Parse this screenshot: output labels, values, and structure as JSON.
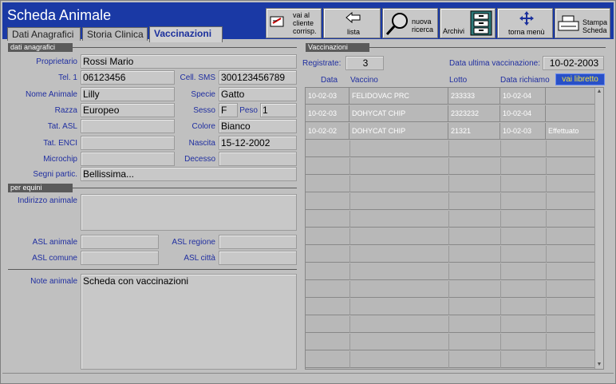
{
  "app": {
    "title": "Scheda Animale"
  },
  "tabs": [
    {
      "label": "Dati Anagrafici"
    },
    {
      "label": "Storia Clinica"
    },
    {
      "label": "Vaccinazioni"
    }
  ],
  "toolbar": {
    "vai_cliente": "vai al cliente corrisp.",
    "lista": "lista",
    "nuova_ricerca": "nuova ricerca",
    "archivi": "Archivi",
    "torna_menu": "torna menù",
    "stampa": "Stampa Scheda"
  },
  "sections": {
    "dati_anagrafici": "dati anagrafici",
    "per_equini": "per equini",
    "vaccinazioni": "Vaccinazioni"
  },
  "form": {
    "proprietario": {
      "label": "Proprietario",
      "value": "Rossi Mario"
    },
    "tel1": {
      "label": "Tel. 1",
      "value": "06123456"
    },
    "cell": {
      "label": "Cell. SMS",
      "value": "300123456789"
    },
    "nome": {
      "label": "Nome Animale",
      "value": "Lilly"
    },
    "specie": {
      "label": "Specie",
      "value": "Gatto"
    },
    "razza": {
      "label": "Razza",
      "value": "Europeo"
    },
    "sesso": {
      "label": "Sesso",
      "value": "F"
    },
    "peso": {
      "label": "Peso",
      "value": "1"
    },
    "tat_asl": {
      "label": "Tat. ASL",
      "value": ""
    },
    "colore": {
      "label": "Colore",
      "value": "Bianco"
    },
    "tat_enci": {
      "label": "Tat. ENCI",
      "value": ""
    },
    "nascita": {
      "label": "Nascita",
      "value": "15-12-2002"
    },
    "microchip": {
      "label": "Microchip",
      "value": ""
    },
    "decesso": {
      "label": "Decesso",
      "value": ""
    },
    "segni": {
      "label": "Segni partic.",
      "value": "Bellissima..."
    },
    "indirizzo": {
      "label": "Indirizzo animale",
      "value": ""
    },
    "asl_animale": {
      "label": "ASL animale",
      "value": ""
    },
    "asl_regione": {
      "label": "ASL regione",
      "value": ""
    },
    "asl_comune": {
      "label": "ASL comune",
      "value": ""
    },
    "asl_citta": {
      "label": "ASL città",
      "value": ""
    },
    "note": {
      "label": "Note animale",
      "value": "Scheda con vaccinazioni"
    }
  },
  "vacc": {
    "registrate_label": "Registrate:",
    "registrate_value": "3",
    "ultima_label": "Data ultima vaccinazione:",
    "ultima_value": "10-02-2003",
    "vai_libretto": "vai libretto",
    "columns": [
      "Data",
      "Vaccino",
      "Lotto",
      "Data richiamo"
    ],
    "rows": [
      {
        "data": "10-02-03",
        "vaccino": "FELIDOVAC PRC",
        "lotto": "233333",
        "richiamo": "10-02-04",
        "stato": ""
      },
      {
        "data": "10-02-03",
        "vaccino": "DOHYCAT CHIP",
        "lotto": "2323232",
        "richiamo": "10-02-04",
        "stato": ""
      },
      {
        "data": "10-02-02",
        "vaccino": "DOHYCAT CHIP",
        "lotto": "21321",
        "richiamo": "10-02-03",
        "stato": "Effettuato"
      }
    ]
  }
}
